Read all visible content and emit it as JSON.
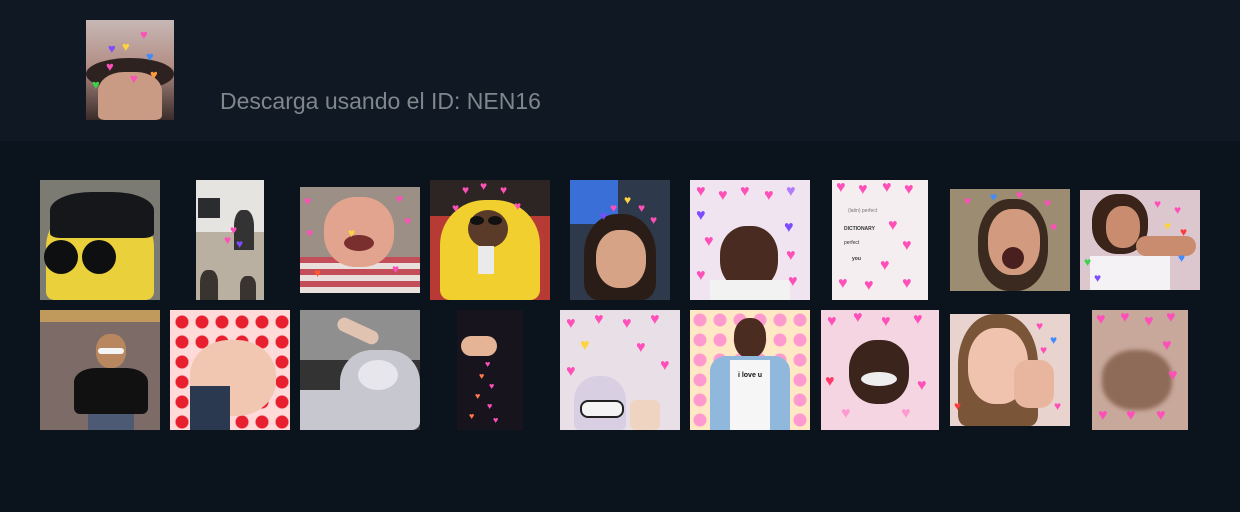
{
  "pack": {
    "icon": "sticker-pack-thumbnail",
    "download_text": "Descarga usando el ID: NEN16"
  },
  "colors": {
    "page_background": "#0b131c",
    "header_background": "#101923",
    "text_muted": "#7f868d",
    "heart_pink": "#ff4fb8"
  },
  "stickers": [
    {
      "name": "sticker-yellow-hood-sunglasses"
    },
    {
      "name": "sticker-office-cabinet"
    },
    {
      "name": "sticker-crying-boy-hearts"
    },
    {
      "name": "sticker-yellow-costume-drink"
    },
    {
      "name": "sticker-selfie-girl-hearts"
    },
    {
      "name": "sticker-boy-purple-hearts"
    },
    {
      "name": "sticker-dictionary-perfect-hearts"
    },
    {
      "name": "sticker-screaming-girl-hearts"
    },
    {
      "name": "sticker-girl-lying-hearts"
    },
    {
      "name": "sticker-girl-sunglasses-wall"
    },
    {
      "name": "sticker-baby-red-hearts"
    },
    {
      "name": "sticker-hand-heart-hoodie"
    },
    {
      "name": "sticker-hand-falling-hearts"
    },
    {
      "name": "sticker-kid-white-sunglasses-hearts"
    },
    {
      "name": "sticker-boy-i-love-u-shirt"
    },
    {
      "name": "sticker-man-crying-flowers"
    },
    {
      "name": "sticker-girl-hand-face-hearts"
    },
    {
      "name": "sticker-blurry-face-hearts"
    }
  ],
  "sticker_texts": {
    "love_shirt": "i love u",
    "dict_line1": "(latin) perfect",
    "dict_line2": "DICTIONARY",
    "dict_line3": "perfect",
    "dict_line4": "you"
  }
}
